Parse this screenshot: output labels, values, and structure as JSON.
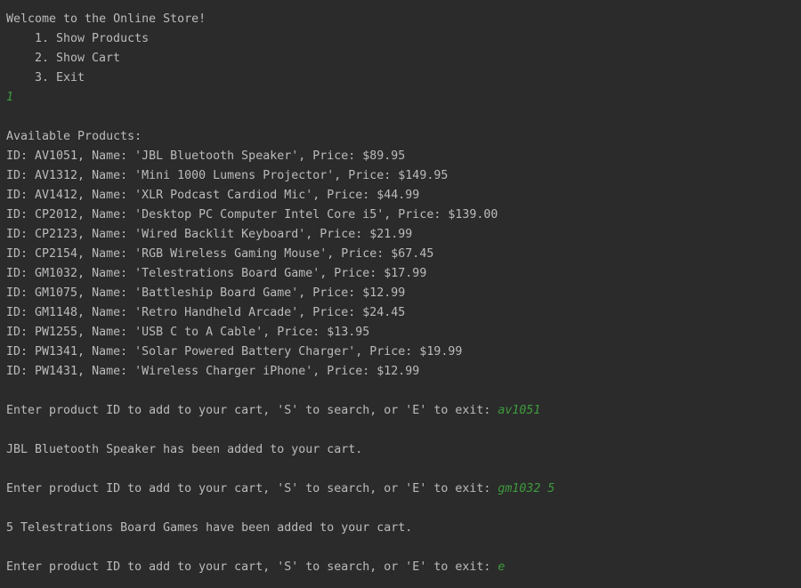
{
  "console": {
    "welcome": "Welcome to the Online Store!",
    "menu": [
      "1. Show Products",
      "2. Show Cart",
      "3. Exit"
    ],
    "menu_choice": "1",
    "products_header": "Available Products:",
    "products": [
      "ID: AV1051, Name: 'JBL Bluetooth Speaker', Price: $89.95",
      "ID: AV1312, Name: 'Mini 1000 Lumens Projector', Price: $149.95",
      "ID: AV1412, Name: 'XLR Podcast Cardiod Mic', Price: $44.99",
      "ID: CP2012, Name: 'Desktop PC Computer Intel Core i5', Price: $139.00",
      "ID: CP2123, Name: 'Wired Backlit Keyboard', Price: $21.99",
      "ID: CP2154, Name: 'RGB Wireless Gaming Mouse', Price: $67.45",
      "ID: GM1032, Name: 'Telestrations Board Game', Price: $17.99",
      "ID: GM1075, Name: 'Battleship Board Game', Price: $12.99",
      "ID: GM1148, Name: 'Retro Handheld Arcade', Price: $24.45",
      "ID: PW1255, Name: 'USB C to A Cable', Price: $13.95",
      "ID: PW1341, Name: 'Solar Powered Battery Charger', Price: $19.99",
      "ID: PW1431, Name: 'Wireless Charger iPhone', Price: $12.99"
    ],
    "prompt": "Enter product ID to add to your cart, 'S' to search, or 'E' to exit: ",
    "input_1": "av1051",
    "message_1": "JBL Bluetooth Speaker has been added to your cart.",
    "input_2": "gm1032 5",
    "message_2": "5 Telestrations Board Games have been added to your cart.",
    "input_3": "e",
    "colors": {
      "background": "#2b2b2b",
      "text": "#bbbbbb",
      "user_input": "#3e9a3e"
    }
  }
}
